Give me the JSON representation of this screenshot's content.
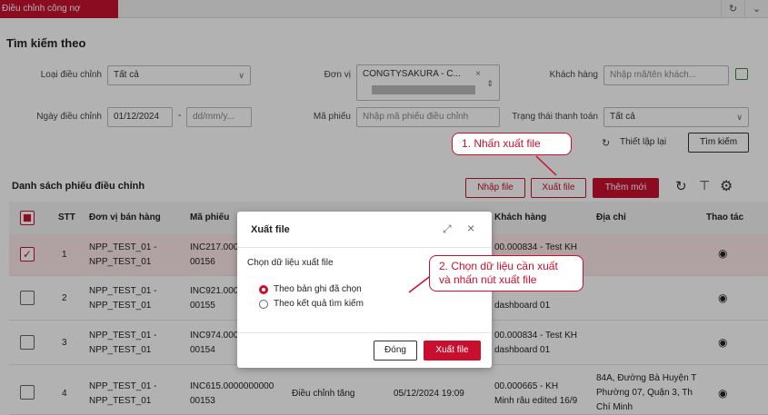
{
  "topbar": {
    "tab": "Điều chỉnh công nợ",
    "icons": [
      "refresh-icon",
      "chevron-down-icon"
    ]
  },
  "search": {
    "title": "Tìm kiếm theo",
    "loai_label": "Loại điều chỉnh",
    "loai_value": "Tất cả",
    "donvi_label": "Đơn vị",
    "donvi_value": "CONGTYSAKURA - C...",
    "kh_label": "Khách hàng",
    "kh_placeholder": "Nhập mã/tên khách...",
    "ngay_label": "Ngày điều chỉnh",
    "ngay_from": "01/12/2024",
    "ngay_sep": "-",
    "ngay_to": "dd/mm/y...",
    "ma_label": "Mã phiếu",
    "ma_placeholder": "Nhập mã phiếu điều chỉnh",
    "tt_label": "Trạng thái thanh toán",
    "tt_value": "Tất cả",
    "reset": "Thiết lập lại",
    "search_btn": "Tìm kiếm"
  },
  "list": {
    "title": "Danh sách phiếu điều chỉnh",
    "import": "Nhập file",
    "export": "Xuất file",
    "add": "Thêm mới",
    "headers": {
      "stt": "STT",
      "donvi": "Đơn vị bán hàng",
      "ma": "Mã phiếu",
      "kh": "Khách hàng",
      "dc": "Địa chỉ",
      "tt": "Thao tác"
    },
    "rows": [
      {
        "stt": "1",
        "dv1": "NPP_TEST_01 -",
        "dv2": "NPP_TEST_01",
        "ma1": "INC217.000",
        "ma2": "00156",
        "kh1": "00.000834 - Test KH",
        "kh2": "",
        "dc": "",
        "loai": "",
        "ngay": ""
      },
      {
        "stt": "2",
        "dv1": "NPP_TEST_01 -",
        "dv2": "NPP_TEST_01",
        "ma1": "INC921.000",
        "ma2": "00155",
        "kh1": "",
        "kh2": "dashboard 01",
        "dc": "",
        "loai": "",
        "ngay": ""
      },
      {
        "stt": "3",
        "dv1": "NPP_TEST_01 -",
        "dv2": "NPP_TEST_01",
        "ma1": "INC974.000",
        "ma2": "00154",
        "kh1": "00.000834 - Test KH",
        "kh2": "dashboard 01",
        "dc": "",
        "loai": "",
        "ngay": ""
      },
      {
        "stt": "4",
        "dv1": "NPP_TEST_01 -",
        "dv2": "NPP_TEST_01",
        "ma1": "INC615.0000000000",
        "ma2": "00153",
        "kh1": "00.000665 - KH",
        "kh2": "Minh râu edited 16/9",
        "dc1": "84A, Đường Bà Huyện T",
        "dc2": "Phường 07, Quận 3, Th",
        "dc3": "Chí Minh",
        "loai": "Điều chỉnh tăng",
        "ngay": "05/12/2024 19:09"
      }
    ]
  },
  "modal": {
    "title": "Xuất file",
    "prompt": "Chọn dữ liệu xuất file",
    "opt1": "Theo bản ghi đã chọn",
    "opt2": "Theo kết quả tìm kiếm",
    "cancel": "Đóng",
    "confirm": "Xuất file"
  },
  "callouts": {
    "c1": "1. Nhấn xuất file",
    "c2a": "2. Chọn dữ liệu cần xuất",
    "c2b": "và nhấn nút xuất file"
  },
  "colors": {
    "accent": "#c8102e"
  }
}
